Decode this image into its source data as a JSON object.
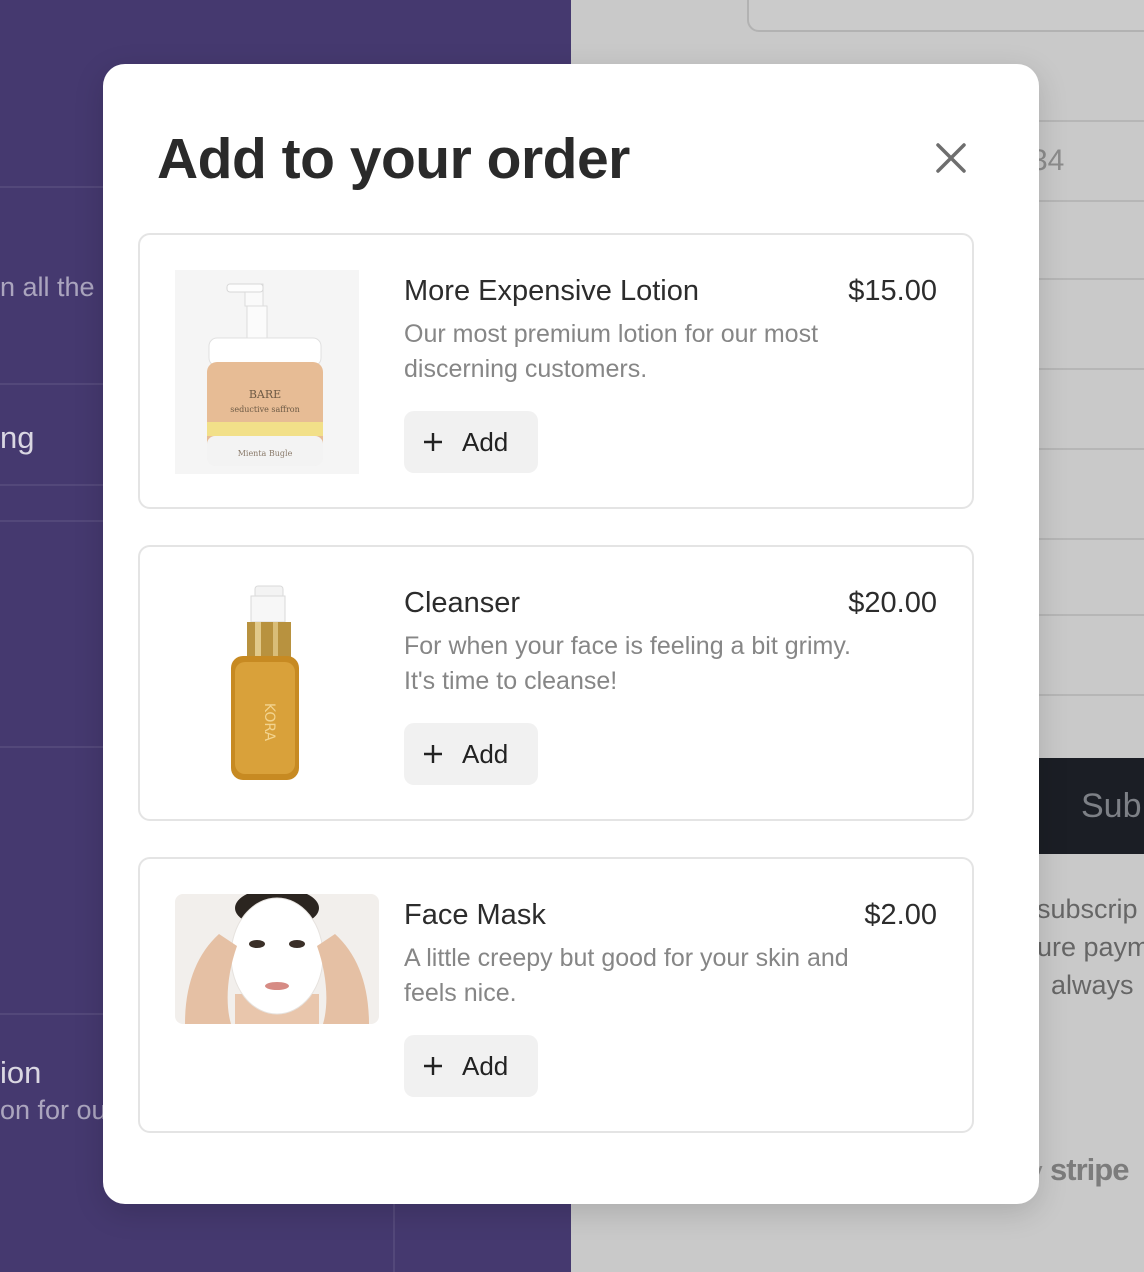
{
  "background": {
    "left_texts": [
      "n all the p",
      "ng",
      "ion",
      "on for ou"
    ],
    "right_field_value": "34",
    "submit_label": "Sub",
    "notice_lines": [
      "subscrip",
      "ure paym",
      "always"
    ],
    "powered_prefix": "y",
    "powered_brand": "stripe"
  },
  "modal": {
    "title": "Add to your order",
    "close_icon": "close-icon",
    "products": [
      {
        "name": "More Expensive Lotion",
        "price": "$15.00",
        "description": "Our most premium lotion for our most discerning customers.",
        "add_label": "Add",
        "image_icon": "lotion-jar-image"
      },
      {
        "name": "Cleanser",
        "price": "$20.00",
        "description": "For when your face is feeling a bit grimy. It's time to cleanse!",
        "add_label": "Add",
        "image_icon": "cleanser-bottle-image"
      },
      {
        "name": "Face Mask",
        "price": "$2.00",
        "description": "A little creepy but good for your skin and feels nice.",
        "add_label": "Add",
        "image_icon": "face-mask-image"
      }
    ]
  },
  "colors": {
    "left_panel": "#45396f",
    "overlay_right": "#c9c9c9",
    "modal_bg": "#ffffff",
    "add_button_bg": "#f1f1f1",
    "text_primary": "#2c2c2c",
    "text_secondary": "#868686"
  }
}
